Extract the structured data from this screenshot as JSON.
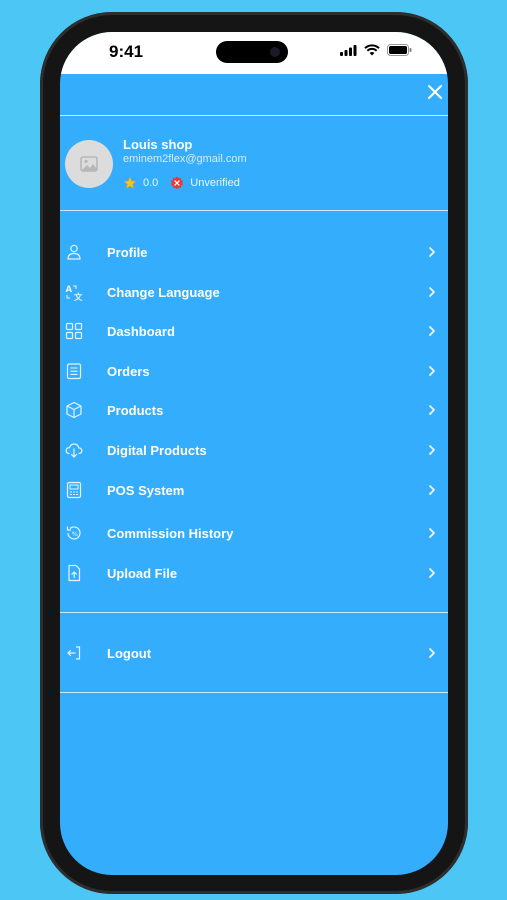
{
  "status_bar": {
    "time": "9:41"
  },
  "profile": {
    "shop_name": "Louis shop",
    "email": "eminem2flex@gmail.com",
    "rating": "0.0",
    "verification": "Unverified"
  },
  "menu": {
    "items": [
      {
        "label": "Profile",
        "icon": "user-icon"
      },
      {
        "label": "Change Language",
        "icon": "translate-icon"
      },
      {
        "label": "Dashboard",
        "icon": "dashboard-icon"
      },
      {
        "label": "Orders",
        "icon": "orders-icon"
      },
      {
        "label": "Products",
        "icon": "box-icon"
      },
      {
        "label": "Digital Products",
        "icon": "cloud-download-icon"
      },
      {
        "label": "POS System",
        "icon": "pos-icon"
      },
      {
        "label": "Commission History",
        "icon": "commission-history-icon"
      },
      {
        "label": "Upload File",
        "icon": "upload-file-icon"
      }
    ],
    "logout_label": "Logout"
  },
  "colors": {
    "page_background": "#4cc6f5",
    "drawer_background": "#34adfd",
    "text": "#ffffff",
    "star": "#f5c518",
    "unverified_badge": "#e53935"
  }
}
